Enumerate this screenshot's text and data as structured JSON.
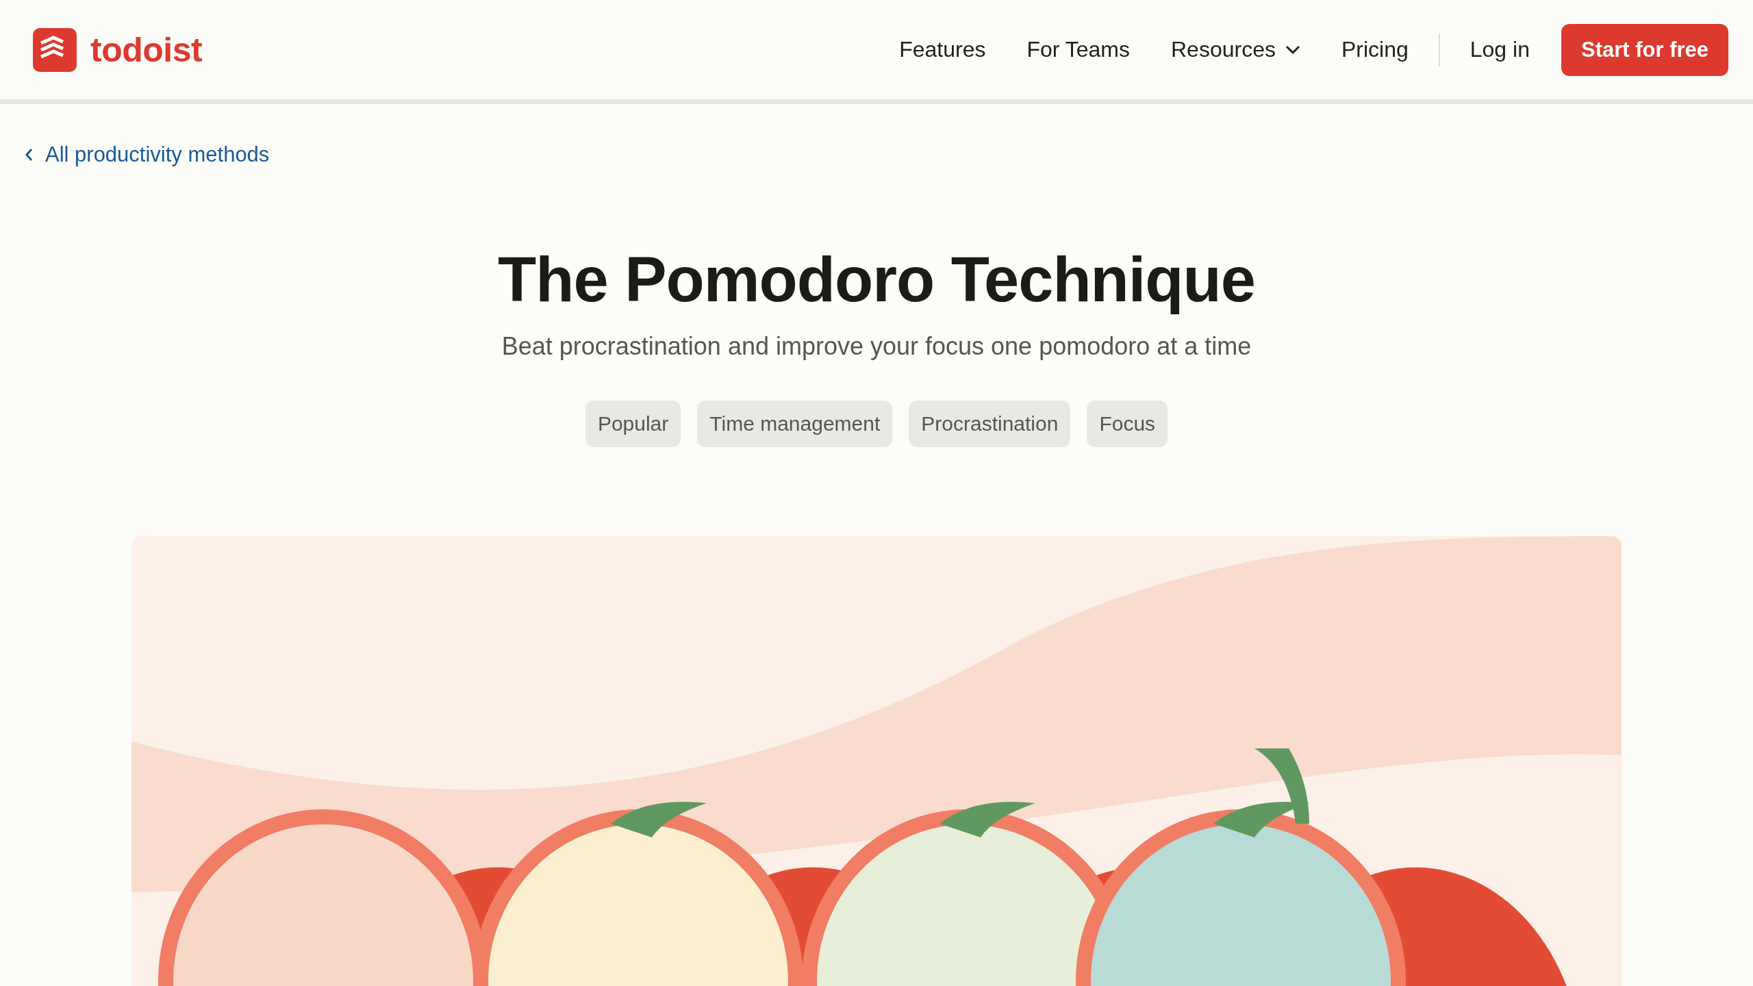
{
  "header": {
    "logo_text": "todoist",
    "nav": [
      {
        "label": "Features",
        "kind": "link"
      },
      {
        "label": "For Teams",
        "kind": "link"
      },
      {
        "label": "Resources",
        "kind": "dropdown"
      },
      {
        "label": "Pricing",
        "kind": "link"
      }
    ],
    "login": "Log in",
    "cta": "Start for free"
  },
  "back_link": "All productivity methods",
  "title": "The Pomodoro Technique",
  "subtitle": "Beat procrastination and improve your focus one pomodoro at a time",
  "tags": [
    "Popular",
    "Time management",
    "Procrastination",
    "Focus"
  ]
}
